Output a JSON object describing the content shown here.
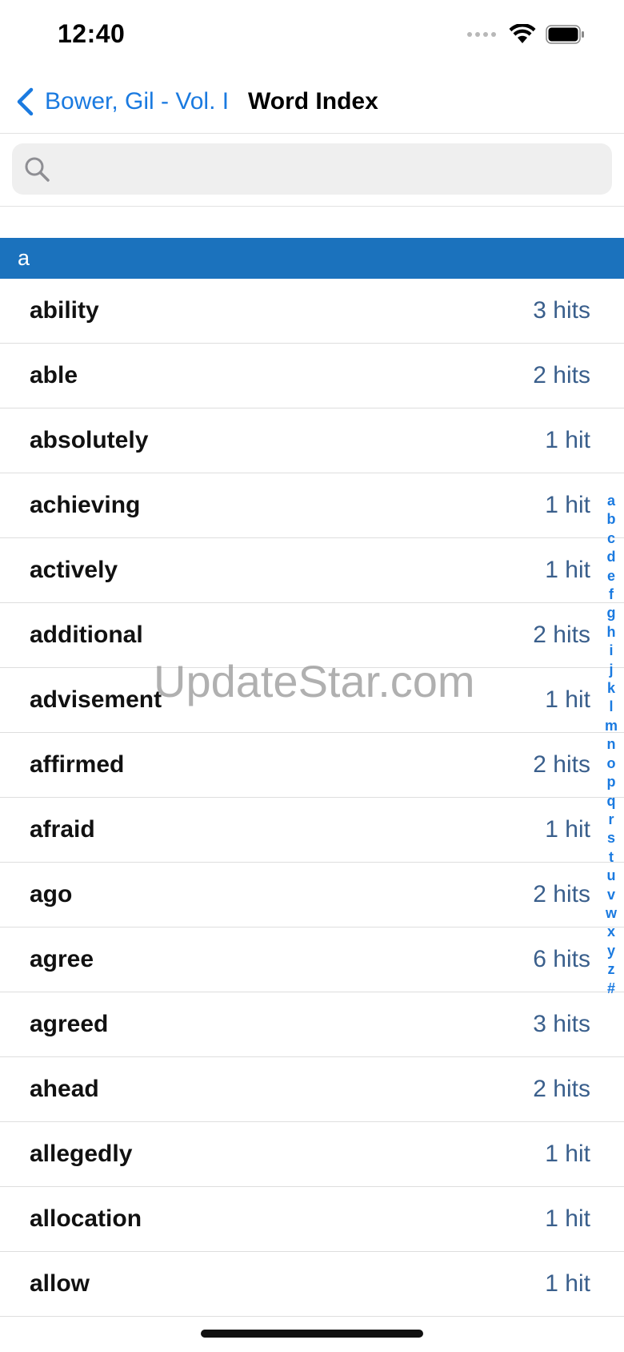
{
  "status_bar": {
    "time": "12:40"
  },
  "nav": {
    "back_label": "Bower, Gil - Vol. I",
    "title": "Word Index",
    "accent_color": "#1a7ae0"
  },
  "search": {
    "placeholder": "",
    "value": ""
  },
  "section": {
    "header": "a",
    "color": "#1b72bd"
  },
  "words": [
    {
      "word": "ability",
      "hits": "3 hits"
    },
    {
      "word": "able",
      "hits": "2 hits"
    },
    {
      "word": "absolutely",
      "hits": "1 hit"
    },
    {
      "word": "achieving",
      "hits": "1 hit"
    },
    {
      "word": "actively",
      "hits": "1 hit"
    },
    {
      "word": "additional",
      "hits": "2 hits"
    },
    {
      "word": "advisement",
      "hits": "1 hit"
    },
    {
      "word": "affirmed",
      "hits": "2 hits"
    },
    {
      "word": "afraid",
      "hits": "1 hit"
    },
    {
      "word": "ago",
      "hits": "2 hits"
    },
    {
      "word": "agree",
      "hits": "6 hits"
    },
    {
      "word": "agreed",
      "hits": "3 hits"
    },
    {
      "word": "ahead",
      "hits": "2 hits"
    },
    {
      "word": "allegedly",
      "hits": "1 hit"
    },
    {
      "word": "allocation",
      "hits": "1 hit"
    },
    {
      "word": "allow",
      "hits": "1 hit"
    }
  ],
  "alphabet_index": [
    "a",
    "b",
    "c",
    "d",
    "e",
    "f",
    "g",
    "h",
    "i",
    "j",
    "k",
    "l",
    "m",
    "n",
    "o",
    "p",
    "q",
    "r",
    "s",
    "t",
    "u",
    "v",
    "w",
    "x",
    "y",
    "z",
    "#"
  ],
  "watermark": "UpdateStar.com"
}
